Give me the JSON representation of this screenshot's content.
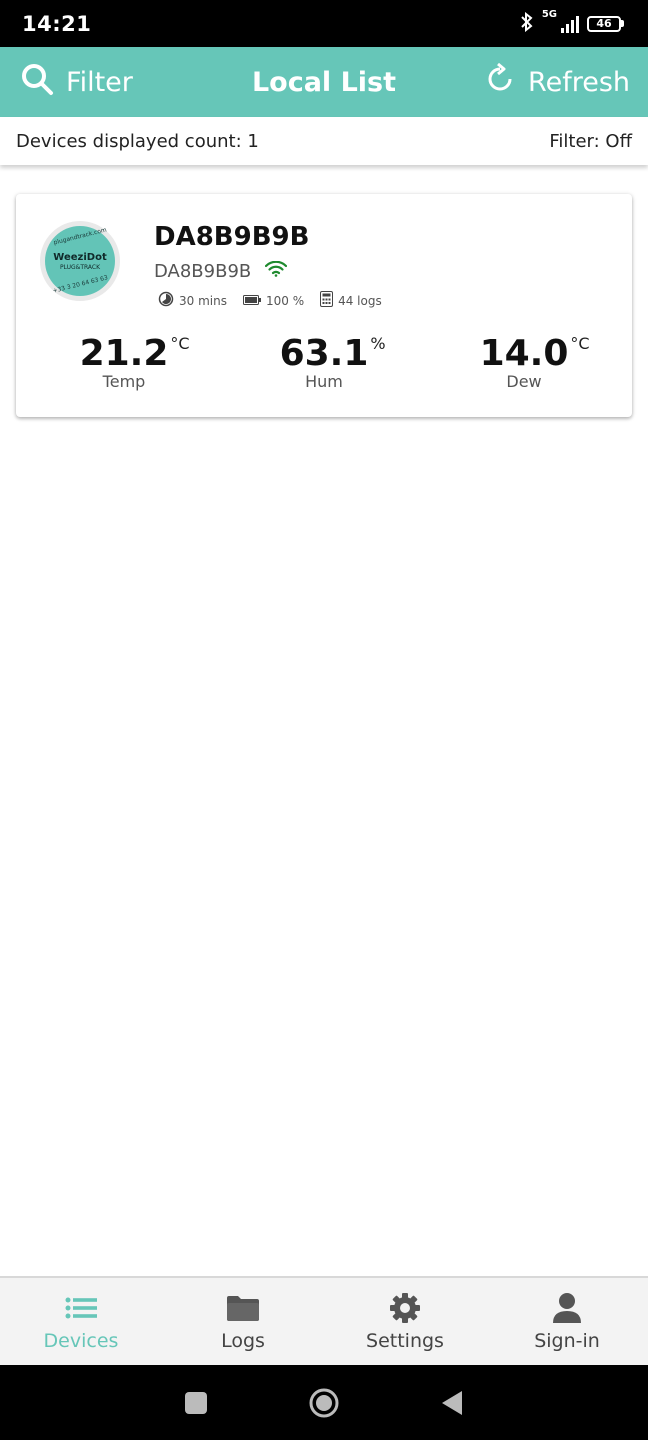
{
  "status_bar": {
    "time": "14:21",
    "network": "5G",
    "battery": "46"
  },
  "app_bar": {
    "filter_label": "Filter",
    "title": "Local List",
    "refresh_label": "Refresh",
    "color": "#66c6b8"
  },
  "subheader": {
    "count_text": "Devices displayed count: 1",
    "filter_status": "Filter: Off"
  },
  "device": {
    "name": "DA8B9B9B",
    "id": "DA8B9B9B",
    "interval": "30 mins",
    "battery": "100 %",
    "logs": "44 logs",
    "logo": {
      "top_text": "plugandtrack.com",
      "brand": "WeeziDot",
      "sub": "PLUG&TRACK",
      "bottom_text": "+33 3 20 64 63 63"
    },
    "readings": [
      {
        "value": "21.2",
        "unit": "°C",
        "label": "Temp"
      },
      {
        "value": "63.1",
        "unit": "%",
        "label": "Hum"
      },
      {
        "value": "14.0",
        "unit": "°C",
        "label": "Dew"
      }
    ]
  },
  "bottom_nav": {
    "items": [
      {
        "label": "Devices",
        "icon": "list-icon",
        "active": true
      },
      {
        "label": "Logs",
        "icon": "folder-icon",
        "active": false
      },
      {
        "label": "Settings",
        "icon": "gear-icon",
        "active": false
      },
      {
        "label": "Sign-in",
        "icon": "person-icon",
        "active": false
      }
    ]
  },
  "colors": {
    "accent": "#66c6b8",
    "wifi": "#1f8a2e"
  }
}
